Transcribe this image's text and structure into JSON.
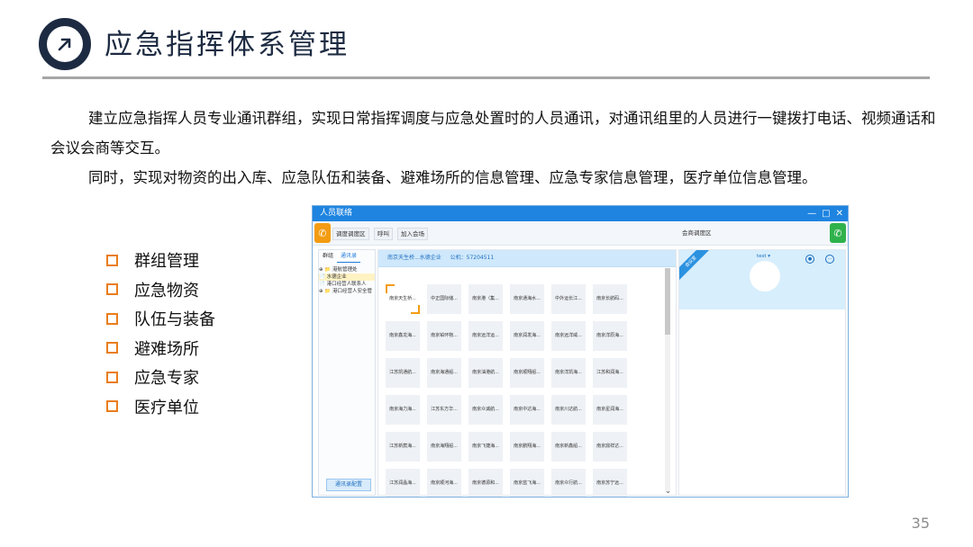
{
  "header": {
    "title": "应急指挥体系管理",
    "icon": "arrow-up-right-icon",
    "accent": "#1d2b42"
  },
  "content": {
    "paragraph1": "建立应急指挥人员专业通讯群组，实现日常指挥调度与应急处置时的人员通讯，对通讯组里的人员进行一键拨打电话、视频通话和会议会商等交互。",
    "paragraph2": "同时，实现对物资的出入库、应急队伍和装备、避难场所的信息管理、应急专家信息管理，医疗单位信息管理。"
  },
  "bullets": {
    "color": "#ea7d1c",
    "items": [
      "群组管理",
      "应急物资",
      "队伍与装备",
      "避难场所",
      "应急专家",
      "医疗单位"
    ]
  },
  "app": {
    "window_title": "人员联络",
    "window_controls": [
      "—",
      "□",
      "✕"
    ],
    "toolbar": {
      "button1": "调度调度区",
      "button2": "呼叫",
      "button3": "加入会场",
      "center_label": "会商调度区"
    },
    "left_panel": {
      "tab_group": "群组",
      "tab_contacts": "通讯录",
      "tree": [
        "⊕ 📁 港航管理处",
        "   📄 水德企业",
        "   📄 港口经营人联系人",
        "⊕ 📁 港口经营人安全管"
      ],
      "bottom_button": "通讯录配置"
    },
    "mid_panel": {
      "company": "南京天生桥...水德企业",
      "phone": "公机：57204511",
      "cards": [
        "南京天生桥...",
        "中正国际储...",
        "南京港（集...",
        "南京通海水...",
        "中外运长江...",
        "南京长航码...",
        "南京鑫龙海...",
        "南京铂环物...",
        "南京远洋运...",
        "南京润发海...",
        "南京远洋威...",
        "南京洋原海...",
        "江苏凯通航...",
        "南京海通船...",
        "南京油港航...",
        "南京顺翔船...",
        "南京洋凯海...",
        "江苏和润海...",
        "南京海力海...",
        "江苏东方华...",
        "南京众诚航...",
        "南京中达海...",
        "南京川达航...",
        "南京星润海...",
        "江苏新宸海...",
        "南京海翔船...",
        "南京飞捷海...",
        "南京鹏翔海...",
        "南京新鑫船...",
        "南京鼎祥达...",
        "江苏润晶海...",
        "南京顺河海...",
        "南京德源和...",
        "南京蓝飞海...",
        "南京众行航...",
        "南京苏宁远..."
      ]
    },
    "right_panel": {
      "ribbon": "会议室",
      "label": "test ▾"
    }
  },
  "page_number": "35"
}
